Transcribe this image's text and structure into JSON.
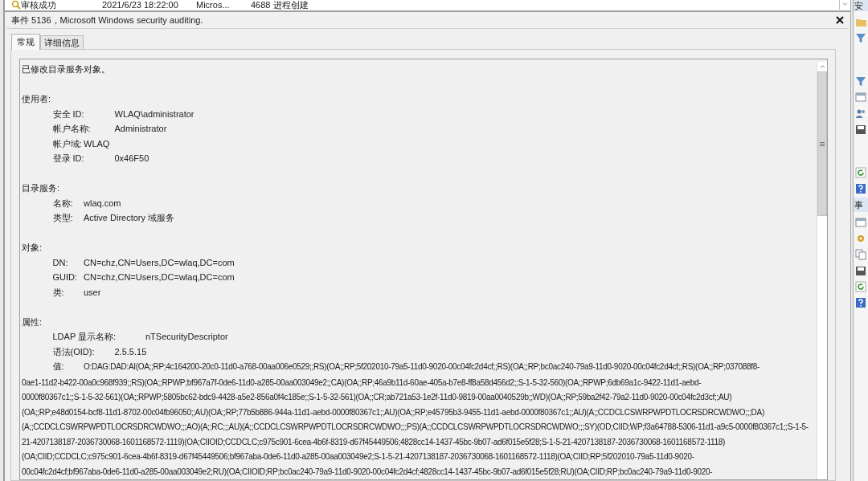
{
  "list_row": {
    "level": "审核成功",
    "date": "2021/6/23 18:22:00",
    "source": "Micros...",
    "event_id": "4688",
    "task": "进程创建"
  },
  "side_panel": {
    "headers": [
      "安",
      "事"
    ]
  },
  "event_panel": {
    "title": "事件 5136，Microsoft Windows security auditing.",
    "tabs": [
      {
        "label": "常规",
        "selected": true
      },
      {
        "label": "详细信息",
        "selected": false
      }
    ],
    "summary": "已修改目录服务对象。",
    "sections": [
      {
        "heading": "使用者:",
        "fields": [
          {
            "label": "安全 ID:",
            "value": "WLAQ\\administrator"
          },
          {
            "label": "帐户名称:",
            "value": "Administrator"
          },
          {
            "label": "帐户域:",
            "value": "WLAQ"
          },
          {
            "label": "登录 ID:",
            "value": "0x46F50"
          }
        ]
      },
      {
        "heading": "目录服务:",
        "fields": [
          {
            "label": "名称:",
            "value": "wlaq.com"
          },
          {
            "label": "类型:",
            "value": "Active Directory 域服务"
          }
        ]
      },
      {
        "heading": "对象:",
        "fields": [
          {
            "label": "DN:",
            "value": "CN=chz,CN=Users,DC=wlaq,DC=com"
          },
          {
            "label": "GUID:",
            "value": "CN=chz,CN=Users,DC=wlaq,DC=com"
          },
          {
            "label": "类:",
            "value": "user"
          }
        ]
      },
      {
        "heading": "属性:",
        "fields": [
          {
            "label": "LDAP 显示名称:",
            "value": "nTSecurityDescriptor"
          },
          {
            "label": "语法(OID):",
            "value": "2.5.5.15"
          },
          {
            "label": "值:",
            "value_lines": [
              "O:DAG:DAD:AI(OA;;RP;4c164200-20c0-11d0-a768-00aa006e0529;;RS)(OA;;RP;5f202010-79a5-11d0-9020-00c04fc2d4cf;;RS)(OA;;RP;bc0ac240-79a9-11d0-9020-00c04fc2d4cf;;RS)(OA;;RP;037088f8-",
              "0ae1-11d2-b422-00a0c968f939;;RS)(OA;;RPWP;bf967a7f-0de6-11d0-a285-00aa003049e2;;CA)(OA;;RP;46a9b11d-60ae-405a-b7e8-ff8a58d456d2;;S-1-5-32-560)(OA;;RPWP;6db69a1c-9422-11d1-aebd-",
              "0000f80367c1;;S-1-5-32-561)(OA;;RPWP;5805bc62-bdc9-4428-a5e2-856a0f4c185e;;S-1-5-32-561)(OA;;CR;ab721a53-1e2f-11d0-9819-00aa0040529b;;WD)(OA;;RP;59ba2f42-79a2-11d0-9020-00c04fc2d3cf;;AU)",
              "(OA;;RP;e48d0154-bcf8-11d1-8702-00c04fb96050;;AU)(OA;;RP;77b5b886-944a-11d1-aebd-0000f80367c1;;AU)(OA;;RP;e45795b3-9455-11d1-aebd-0000f80367c1;;AU)(A;;CCDCLCSWRPWPDTLOCRSDRCWDWO;;;DA)",
              "(A;;CCDCLCSWRPWPDTLOCRSDRCWDWO;;;AO)(A;;RC;;;AU)(A;;CCDCLCSWRPWPDTLOCRSDRCWDWO;;;PS)(A;;CCDCLCSWRPWPDTLOCRSDRCWDWO;;;SY)(OD;CIID;WP;f3a64788-5306-11d1-a9c5-0000f80367c1;;S-1-5-",
              "21-4207138187-2036730068-1601168572-1119)(OA;CIIOID;CCDCLC;c975c901-6cea-4b6f-8319-d67f45449506;4828cc14-1437-45bc-9b07-ad6f015e5f28;S-1-5-21-4207138187-2036730068-1601168572-1118)",
              "(OA;CIID;CCDCLC;c975c901-6cea-4b6f-8319-d67f45449506;bf967aba-0de6-11d0-a285-00aa003049e2;S-1-5-21-4207138187-2036730068-1601168572-1118)(OA;CIID;RP;5f202010-79a5-11d0-9020-",
              "00c04fc2d4cf;bf967aba-0de6-11d0-a285-00aa003049e2;RU)(OA;CIIOID;RP;bc0ac240-79a9-11d0-9020-00c04fc2d4cf;4828cc14-1437-45bc-9b07-ad6f015e5f28;RU)(OA;CIID;RP;bc0ac240-79a9-11d0-9020-"
            ]
          }
        ]
      }
    ]
  }
}
